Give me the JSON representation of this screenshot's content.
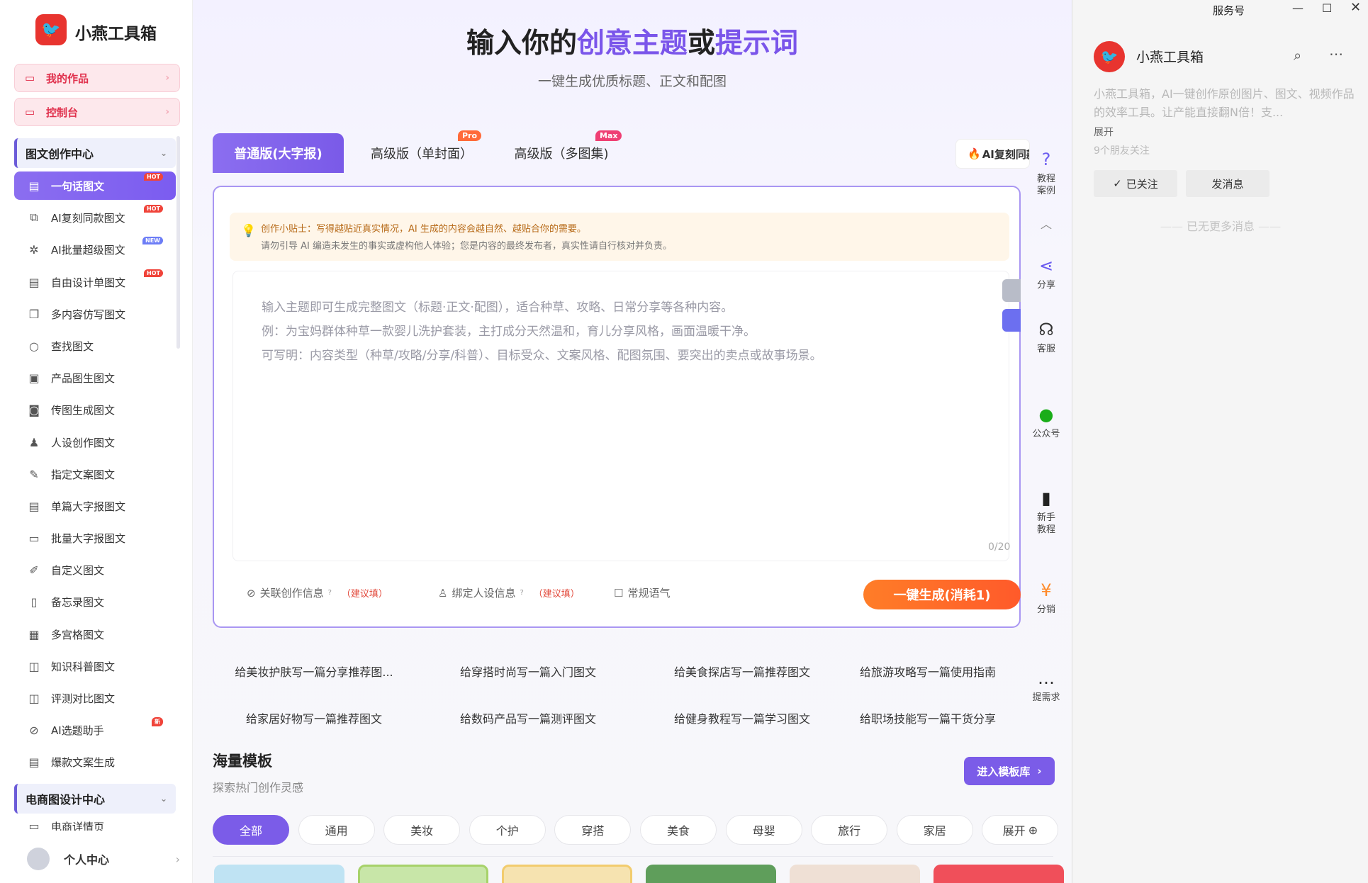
{
  "app": {
    "logo_glyph": "🐦",
    "name": "小燕工具箱"
  },
  "sidebar": {
    "my_works": "我的作品",
    "console": "控制台",
    "section_graphic": "图文创作中心",
    "items": [
      {
        "label": "一句话图文",
        "icon": "document-icon",
        "glyph": "▤",
        "badge": "HOT",
        "badge_type": "hot",
        "active": true
      },
      {
        "label": "AI复刻同款图文",
        "icon": "copy-icon",
        "glyph": "⧉",
        "badge": "HOT",
        "badge_type": "hot"
      },
      {
        "label": "AI批量超级图文",
        "icon": "sparkle-icon",
        "glyph": "✲",
        "badge": "NEW",
        "badge_type": "new"
      },
      {
        "label": "自由设计单图文",
        "icon": "file-icon",
        "glyph": "▤",
        "badge": "HOT",
        "badge_type": "hot"
      },
      {
        "label": "多内容仿写图文",
        "icon": "files-icon",
        "glyph": "❐"
      },
      {
        "label": "查找图文",
        "icon": "search-icon",
        "glyph": "○"
      },
      {
        "label": "产品图生图文",
        "icon": "image-icon",
        "glyph": "▣"
      },
      {
        "label": "传图生成图文",
        "icon": "camera-icon",
        "glyph": "◙"
      },
      {
        "label": "人设创作图文",
        "icon": "person-icon",
        "glyph": "♟"
      },
      {
        "label": "指定文案图文",
        "icon": "edit-icon",
        "glyph": "✎"
      },
      {
        "label": "单篇大字报图文",
        "icon": "page-icon",
        "glyph": "▤"
      },
      {
        "label": "批量大字报图文",
        "icon": "stack-icon",
        "glyph": "▭"
      },
      {
        "label": "自定义图文",
        "icon": "pen-icon",
        "glyph": "✐"
      },
      {
        "label": "备忘录图文",
        "icon": "memo-icon",
        "glyph": "▯"
      },
      {
        "label": "多宫格图文",
        "icon": "grid-icon",
        "glyph": "▦"
      },
      {
        "label": "知识科普图文",
        "icon": "book-icon",
        "glyph": "◫"
      },
      {
        "label": "评测对比图文",
        "icon": "compare-icon",
        "glyph": "◫"
      },
      {
        "label": "AI选题助手",
        "icon": "compass-icon",
        "glyph": "⊘",
        "badge": "新",
        "badge_type": "hot"
      },
      {
        "label": "爆款文案生成",
        "icon": "list-icon",
        "glyph": "▤"
      }
    ],
    "section_ecom": "电商图设计中心",
    "ecom_item": "电商详情页",
    "user": "个人中心"
  },
  "main": {
    "title_part1": "输入你的",
    "title_hl1": "创意主题",
    "title_part2": "或",
    "title_hl2": "提示词",
    "subtitle": "一键生成优质标题、正文和配图",
    "tabs": [
      {
        "label": "普通版(大字报)"
      },
      {
        "label": "高级版（单封面）",
        "tag": "Pro"
      },
      {
        "label": "高级版（多图集)",
        "tag": "Max"
      }
    ],
    "ai_button": "AI复刻同款",
    "tip_line1": "创作小贴士：写得越贴近真实情况，AI 生成的内容会越自然、越贴合你的需要。",
    "tip_line2": "请勿引导 AI 编造未发生的事实或虚构他人体验；您是内容的最终发布者，真实性请自行核对并负责。",
    "placeholder_lines": [
      "输入主题即可生成完整图文（标题·正文·配图），适合种草、攻略、日常分享等各种内容。",
      "例：为宝妈群体种草一款婴儿洗护套装，主打成分天然温和，育儿分享风格，画面温暖干净。",
      "可写明：内容类型（种草/攻略/分享/科普）、目标受众、文案风格、配图氛围、要突出的卖点或故事场景。"
    ],
    "counter": "0/20",
    "opt1": "关联创作信息",
    "opt1_hint": "（建议填）",
    "opt2": "绑定人设信息",
    "opt2_hint": "（建议填）",
    "opt3": "常规语气",
    "generate": "一键生成(消耗1)",
    "suggestions": [
      "给美妆护肤写一篇分享推荐图...",
      "给穿搭时尚写一篇入门图文",
      "给美食探店写一篇推荐图文",
      "给旅游攻略写一篇使用指南",
      "给家居好物写一篇推荐图文",
      "给数码产品写一篇测评图文",
      "给健身教程写一篇学习图文",
      "给职场技能写一篇干货分享"
    ],
    "templates_title": "海量模板",
    "templates_sub": "探索热门创作灵感",
    "templates_btn": "进入模板库",
    "chips": [
      "全部",
      "通用",
      "美妆",
      "个护",
      "穿搭",
      "美食",
      "母婴",
      "旅行",
      "家居",
      "展开"
    ],
    "card_colors": [
      "#bfe3f3",
      "#c8e6a8",
      "#f6e3b0",
      "#5f9e5b",
      "#efe0d5",
      "#f04f5a"
    ]
  },
  "rail": [
    {
      "label": "教程\n案例",
      "icon": "help-icon",
      "glyph": "?"
    },
    {
      "label": "分享",
      "icon": "share-icon",
      "glyph": "⋖"
    },
    {
      "label": "客服",
      "icon": "headset-icon",
      "glyph": "☊"
    },
    {
      "label": "公众号",
      "icon": "wechat-icon",
      "glyph": "●"
    },
    {
      "label": "新手\n教程",
      "icon": "guide-icon",
      "glyph": "▮"
    },
    {
      "label": "分销",
      "icon": "money-icon",
      "glyph": "¥"
    },
    {
      "label": "提需求",
      "icon": "chat-bubble-icon",
      "glyph": "…"
    }
  ],
  "chat": {
    "window_title": "服务号",
    "name": "小燕工具箱",
    "desc": "小燕工具箱，AI一键创作原创图片、图文、视频作品的效率工具。让产能直接翻N倍！支...",
    "expand": "展开",
    "friends": "9个朋友关注",
    "followed": "已关注",
    "message": "发消息",
    "no_more": "已无更多消息"
  },
  "colors": {
    "accent": "#7b5ce8",
    "orange": "#ff6a28",
    "brand_red": "#e8342f"
  }
}
